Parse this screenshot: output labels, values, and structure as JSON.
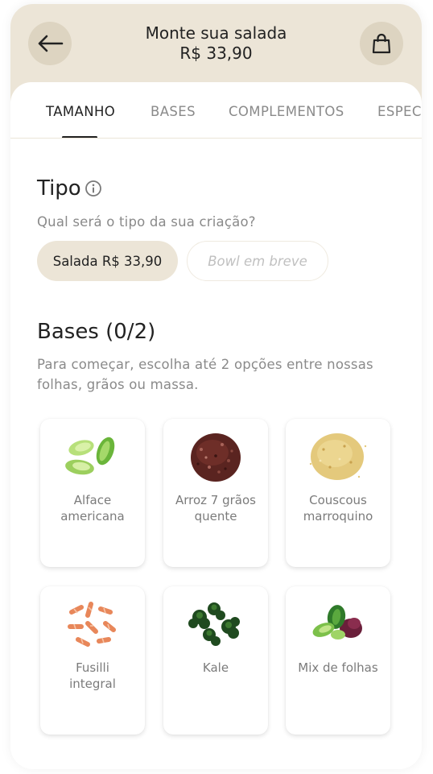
{
  "header": {
    "title": "Monte sua salada",
    "price": "R$ 33,90",
    "back_icon": "arrow-left-icon",
    "bag_icon": "shopping-bag-icon"
  },
  "tabs": [
    {
      "label": "TAMANHO",
      "active": true
    },
    {
      "label": "BASES",
      "active": false
    },
    {
      "label": "COMPLEMENTOS",
      "active": false
    },
    {
      "label": "ESPECIAIS",
      "active": false
    }
  ],
  "tipo": {
    "title": "Tipo",
    "info_icon": "info-icon",
    "question": "Qual será o tipo da sua criação?",
    "options": [
      {
        "label": "Salada R$ 33,90",
        "selected": true
      },
      {
        "label": "Bowl em breve",
        "disabled": true
      }
    ]
  },
  "bases": {
    "title": "Bases (0/2)",
    "description_line1": "Para começar, escolha até 2 opções entre nossas",
    "description_line2": "folhas, grãos ou massa.",
    "items": [
      {
        "line1": "Alface",
        "line2": "americana",
        "image": "lettuce-image"
      },
      {
        "line1": "Arroz 7 grãos",
        "line2": "quente",
        "image": "rice-image"
      },
      {
        "line1": "Couscous",
        "line2": "marroquino",
        "image": "couscous-image"
      },
      {
        "line1": "Fusilli",
        "line2": "integral",
        "image": "fusilli-image"
      },
      {
        "line1": "Kale",
        "line2": "",
        "image": "kale-image"
      },
      {
        "line1": "Mix de folhas",
        "line2": "",
        "image": "mixed-greens-image"
      }
    ]
  },
  "colors": {
    "header_bg": "#ece5d7",
    "button_bg": "#ddd4c1",
    "text_dark": "#222222",
    "text_muted": "#8a8a8a"
  }
}
